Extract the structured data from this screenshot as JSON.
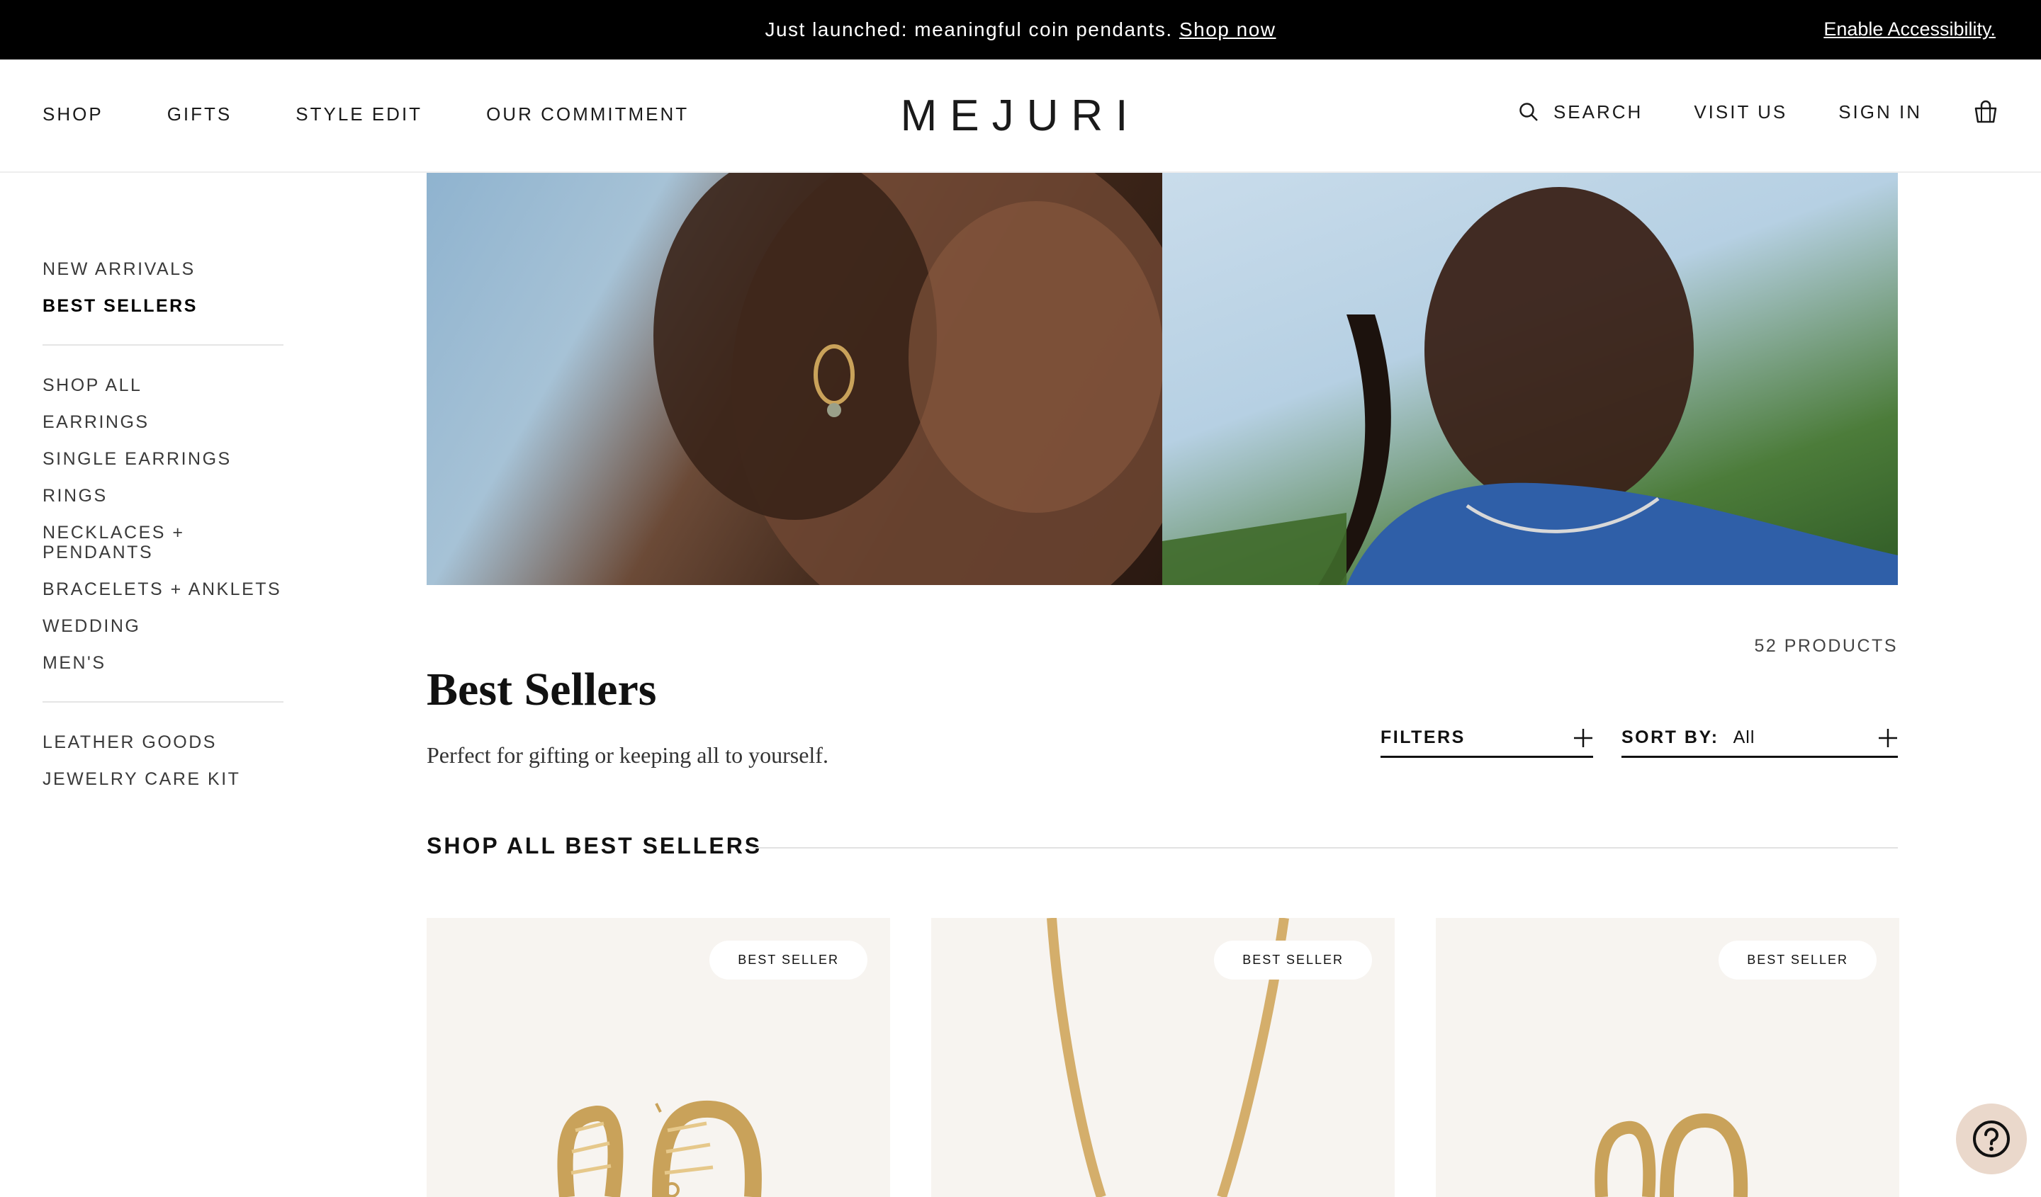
{
  "announcement": {
    "message": "Just launched: meaningful coin pendants.",
    "link": "Shop now",
    "accessibility": "Enable Accessibility."
  },
  "header": {
    "nav_left": [
      "SHOP",
      "GIFTS",
      "STYLE EDIT",
      "OUR COMMITMENT"
    ],
    "logo": "MEJURI",
    "search_label": "SEARCH",
    "visit_label": "VISIT US",
    "signin_label": "SIGN IN"
  },
  "sidebar": {
    "group1": [
      "NEW ARRIVALS",
      "BEST SELLERS"
    ],
    "group2": [
      "SHOP ALL",
      "EARRINGS",
      "SINGLE EARRINGS",
      "RINGS",
      "NECKLACES + PENDANTS",
      "BRACELETS + ANKLETS",
      "WEDDING",
      "MEN'S"
    ],
    "group3": [
      "LEATHER GOODS",
      "JEWELRY CARE KIT"
    ],
    "active": "BEST SELLERS"
  },
  "main": {
    "product_count": "52 PRODUCTS",
    "title": "Best Sellers",
    "subtitle": "Perfect for gifting or keeping all to yourself.",
    "filters_label": "FILTERS",
    "sort_label": "SORT BY:",
    "sort_value": "All",
    "section_heading": "SHOP ALL BEST SELLERS"
  },
  "products": [
    {
      "badge": "BEST SELLER",
      "icon": "croissant-hoop-earrings"
    },
    {
      "badge": "BEST SELLER",
      "icon": "herringbone-chain"
    },
    {
      "badge": "BEST SELLER",
      "icon": "hoop-earrings"
    }
  ],
  "colors": {
    "announcement_bg": "#000000",
    "card_bg": "#f7f4f0",
    "help_bg": "#ead8cb",
    "gold": "#c9a25a"
  },
  "icons": {
    "search": "search-icon",
    "bag": "shopping-bag-icon",
    "plus": "plus-icon",
    "help": "help-icon"
  }
}
